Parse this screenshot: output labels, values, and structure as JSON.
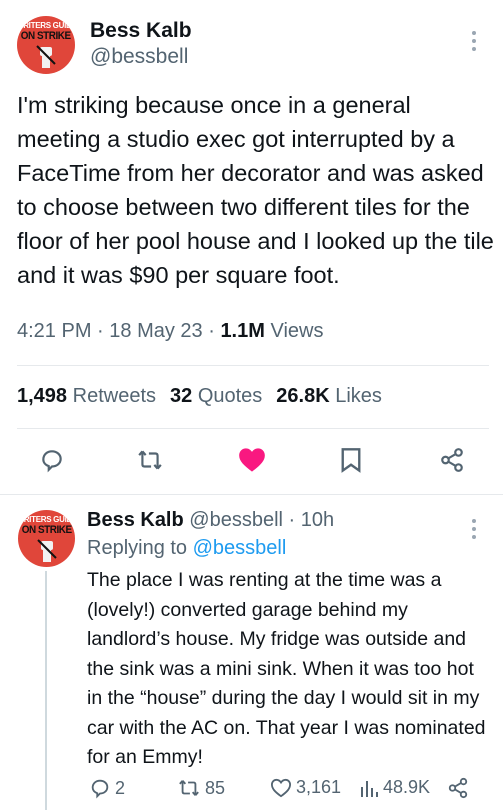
{
  "tweet": {
    "avatar": {
      "top": "WRITERS GUILD",
      "main": "ON STRIKE"
    },
    "name": "Bess Kalb",
    "handle": "@bessbell",
    "text": "I'm striking because once in a general meeting a studio exec got interrupted by a FaceTime from her decorator and was asked to choose between two different tiles for the floor of her pool house and I looked up the tile and it was $90 per square foot.",
    "time": "4:21 PM",
    "date": "18 May 23",
    "views_count": "1.1M",
    "views_label": "Views",
    "retweets_count": "1,498",
    "retweets_label": "Retweets",
    "quotes_count": "32",
    "quotes_label": "Quotes",
    "likes_count": "26.8K",
    "likes_label": "Likes",
    "like_color": "#f91880"
  },
  "reply": {
    "avatar": {
      "top": "WRITERS GUILD",
      "main": "ON STRIKE"
    },
    "name": "Bess Kalb",
    "handle": "@bessbell",
    "age": "10h",
    "replying_prefix": "Replying to",
    "replying_to": "@bessbell",
    "text": "The place I was renting at the time was a (lovely!) converted garage behind my landlord’s house. My fridge was outside and the sink was a mini sink. When it was too hot in the “house” during the day I would sit in my car with the AC on. That year I was nominated for an Emmy!",
    "replies": "2",
    "retweets": "85",
    "likes": "3,161",
    "views": "48.9K"
  },
  "icons": [
    "reply-icon",
    "retweet-icon",
    "like-icon",
    "bookmark-icon",
    "share-icon",
    "views-icon",
    "more-icon"
  ]
}
